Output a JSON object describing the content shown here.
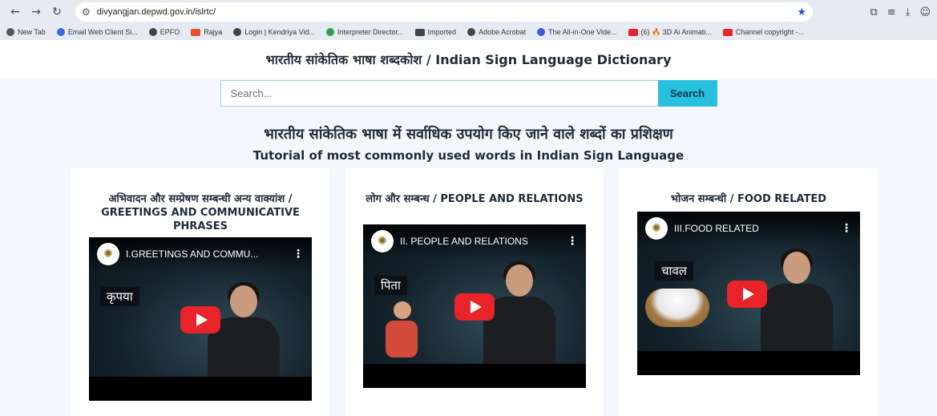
{
  "browser": {
    "url": "divyangjan.depwd.gov.in/islrtc/",
    "bookmarks": [
      {
        "label": "New Tab",
        "color": "#555555"
      },
      {
        "label": "Email Web Client Si...",
        "color": "#3b6bd6"
      },
      {
        "label": "EPFO",
        "color": "#444444"
      },
      {
        "label": "Rajya",
        "color": "#e0532b"
      },
      {
        "label": "Login | Kendriya Vid...",
        "color": "#444444"
      },
      {
        "label": "Interpreter Director...",
        "color": "#2f9e4f"
      },
      {
        "label": "Imported",
        "color": "#444444"
      },
      {
        "label": "Adobe Acrobat",
        "color": "#444444"
      },
      {
        "label": "The All-in-One Vide...",
        "color": "#3b5fd6"
      },
      {
        "label": "(6) 🔥 3D Ai Animati...",
        "color": "#e8232a"
      },
      {
        "label": "Channel copyright -...",
        "color": "#e8232a"
      }
    ]
  },
  "header": {
    "title": "भारतीय सांकेतिक भाषा शब्दकोश / Indian Sign Language Dictionary"
  },
  "search": {
    "placeholder": "Search...",
    "button": "Search"
  },
  "tutorial": {
    "title_hi": "भारतीय सांकेतिक भाषा में सर्वाधिक उपयोग किए जाने वाले शब्दों का प्रशिक्षण",
    "title_en": "Tutorial of most commonly used words in Indian Sign Language"
  },
  "cards": [
    {
      "title": "अभिवादन और सम्प्रेषण सम्बन्धी अन्य वाक्यांश / GREETINGS AND COMMUNICATIVE PHRASES",
      "video_title": "I.GREETINGS AND COMMU...",
      "word": "कृपया"
    },
    {
      "title": "लोग और सम्बन्ध / PEOPLE AND RELATIONS",
      "video_title": "II. PEOPLE AND RELATIONS",
      "word": "पिता"
    },
    {
      "title": "भोजन सम्बन्धी / FOOD RELATED",
      "video_title": "III.FOOD RELATED",
      "word": "चावल"
    }
  ],
  "colors": {
    "accent": "#27c0de",
    "play": "#e8232a"
  }
}
